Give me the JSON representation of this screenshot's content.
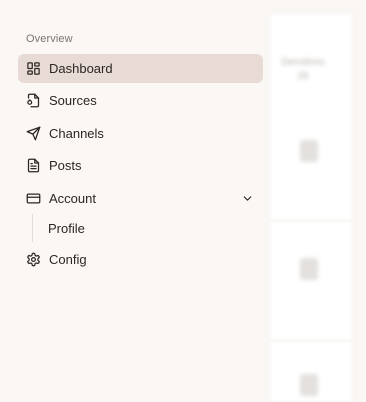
{
  "sidebar": {
    "section_label": "Overview",
    "items": [
      {
        "label": "Dashboard",
        "icon": "dashboard-grid-icon",
        "active": true
      },
      {
        "label": "Sources",
        "icon": "file-source-icon"
      },
      {
        "label": "Channels",
        "icon": "send-icon"
      },
      {
        "label": "Posts",
        "icon": "document-icon"
      },
      {
        "label": "Account",
        "icon": "credit-card-icon",
        "expanded": true,
        "children": [
          {
            "label": "Profile"
          }
        ]
      },
      {
        "label": "Config",
        "icon": "gear-icon"
      }
    ]
  },
  "background": {
    "blurred_heading": "Dernières\n25"
  },
  "colors": {
    "page_bg": "#fbf7f4",
    "active_bg": "#e8dbd5",
    "text": "#2b2623",
    "muted_text": "#7b746f"
  }
}
